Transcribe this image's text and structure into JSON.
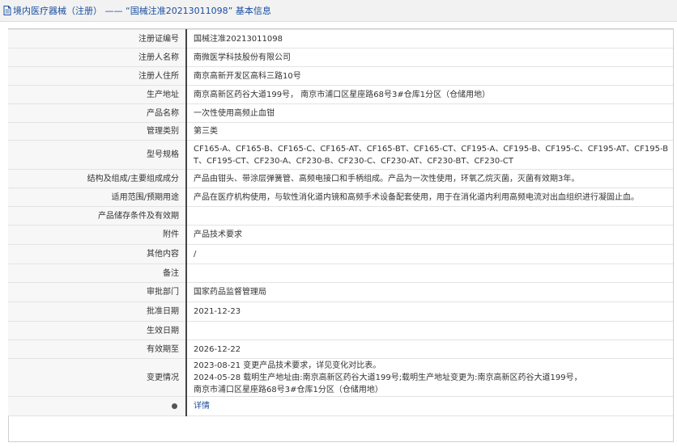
{
  "header": {
    "title": "境内医疗器械（注册） —— “国械注准20213011098” 基本信息"
  },
  "rows": [
    {
      "label": "注册证编号",
      "value": "国械注准20213011098"
    },
    {
      "label": "注册人名称",
      "value": "南微医学科技股份有限公司"
    },
    {
      "label": "注册人住所",
      "value": "南京高新开发区高科三路10号"
    },
    {
      "label": "生产地址",
      "value": "南京高新区药谷大道199号， 南京市浦口区星座路68号3#仓库1分区（仓储用地）"
    },
    {
      "label": "产品名称",
      "value": "一次性使用高频止血钳"
    },
    {
      "label": "管理类别",
      "value": "第三类"
    },
    {
      "label": "型号规格",
      "value": "CF165-A、CF165-B、CF165-C、CF165-AT、CF165-BT、CF165-CT、CF195-A、CF195-B、CF195-C、CF195-AT、CF195-BT、CF195-CT、CF230-A、CF230-B、CF230-C、CF230-AT、CF230-BT、CF230-CT"
    },
    {
      "label": "结构及组成/主要组成成分",
      "value": "产品由钳头、带涂层弹簧管、高频电接口和手柄组成。产品为一次性使用，环氧乙烷灭菌，灭菌有效期3年。"
    },
    {
      "label": "适用范围/预期用途",
      "value": "产品在医疗机构使用，与软性消化道内镜和高频手术设备配套使用，用于在消化道内利用高频电流对出血组织进行凝固止血。"
    },
    {
      "label": "产品储存条件及有效期",
      "value": ""
    },
    {
      "label": "附件",
      "value": "产品技术要求"
    },
    {
      "label": "其他内容",
      "value": "/"
    },
    {
      "label": "备注",
      "value": ""
    },
    {
      "label": "审批部门",
      "value": "国家药品监督管理局"
    },
    {
      "label": "批准日期",
      "value": "2021-12-23"
    },
    {
      "label": "生效日期",
      "value": ""
    },
    {
      "label": "有效期至",
      "value": "2026-12-22"
    }
  ],
  "change": {
    "label": "变更情况",
    "lines": [
      "2023-08-21 变更产品技术要求，详见变化对比表。",
      "2024-05-28 载明生产地址由:南京高新区药谷大道199号;载明生产地址变更为:南京高新区药谷大道199号，",
      "南京市浦口区星座路68号3#仓库1分区（仓储用地）"
    ]
  },
  "detail": {
    "value": "详情"
  }
}
